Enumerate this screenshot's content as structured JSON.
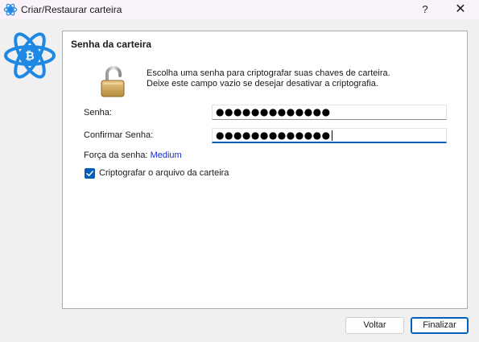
{
  "window": {
    "title": "Criar/Restaurar carteira",
    "help_label": "?",
    "close_label": "✕",
    "icon": "electrum-icon"
  },
  "logo": {
    "icon": "electrum-bitcoin-logo",
    "color": "#1e88e5"
  },
  "panel": {
    "title": "Senha da carteira",
    "lock_icon": "lock-open-icon",
    "message_line1": "Escolha uma senha para criptografar suas chaves de carteira.",
    "message_line2": "Deixe este campo vazio se desejar desativar a criptografia.",
    "password_label": "Senha:",
    "password_value": "●●●●●●●●●●●●●",
    "confirm_label": "Confirmar Senha:",
    "confirm_value": "●●●●●●●●●●●●●",
    "strength_label": "Força da senha:",
    "strength_value": "Medium",
    "encrypt_checkbox_label": "Criptografar o arquivo da carteira",
    "encrypt_checked": true
  },
  "buttons": {
    "back": "Voltar",
    "finish": "Finalizar"
  },
  "colors": {
    "accent": "#005fb8",
    "strength": "#1b2ad0",
    "logo_blue": "#1e88e5"
  }
}
